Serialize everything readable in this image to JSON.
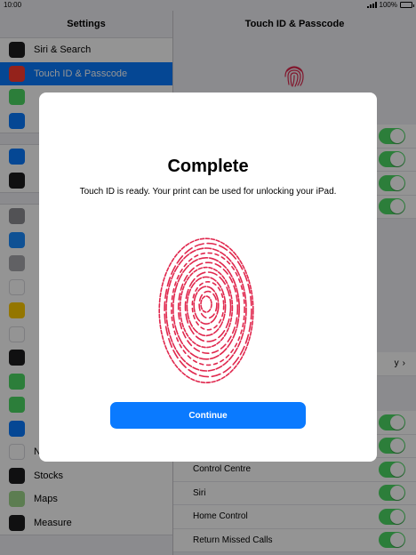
{
  "status_bar": {
    "time": "10:00",
    "battery": "100%"
  },
  "master": {
    "title": "Settings",
    "groups": [
      {
        "items": [
          {
            "label": "Siri & Search",
            "icon": "siri-icon",
            "color": "#1c1c1e"
          },
          {
            "label": "Touch ID & Passcode",
            "icon": "fingerprint-icon",
            "color": "#ff3b30",
            "selected": true
          },
          {
            "label": "",
            "icon": "battery-icon",
            "color": "#4cd964"
          },
          {
            "label": "",
            "icon": "privacy-hand-icon",
            "color": "#0a7aff"
          }
        ]
      },
      {
        "items": [
          {
            "label": "",
            "icon": "app-store-icon",
            "color": "#0a7aff"
          },
          {
            "label": "",
            "icon": "wallet-icon",
            "color": "#1c1c1e"
          }
        ]
      },
      {
        "items": [
          {
            "label": "",
            "icon": "passwords-key-icon",
            "color": "#8e8e93"
          },
          {
            "label": "",
            "icon": "mail-icon",
            "color": "#1a8cff"
          },
          {
            "label": "",
            "icon": "contacts-icon",
            "color": "#a8a8ad"
          },
          {
            "label": "",
            "icon": "calendar-icon",
            "color": "#ffffff"
          },
          {
            "label": "",
            "icon": "notes-icon",
            "color": "#ffcc00"
          },
          {
            "label": "",
            "icon": "reminders-icon",
            "color": "#ffffff"
          },
          {
            "label": "",
            "icon": "voice-memos-icon",
            "color": "#1c1c1e"
          },
          {
            "label": "",
            "icon": "messages-icon",
            "color": "#4cd964"
          },
          {
            "label": "",
            "icon": "facetime-icon",
            "color": "#4cd964"
          },
          {
            "label": "",
            "icon": "safari-icon",
            "color": "#0a7aff"
          },
          {
            "label": "News",
            "icon": "news-icon",
            "color": "#ffffff"
          },
          {
            "label": "Stocks",
            "icon": "stocks-icon",
            "color": "#1c1c1e"
          },
          {
            "label": "Maps",
            "icon": "maps-icon",
            "color": "#9fd88c"
          },
          {
            "label": "Measure",
            "icon": "measure-icon",
            "color": "#1c1c1e"
          }
        ]
      }
    ]
  },
  "detail": {
    "title": "Touch ID & Passcode",
    "partial_value": "y",
    "rows": [
      {
        "label": "Control Centre",
        "toggle": true
      },
      {
        "label": "Siri",
        "toggle": true
      },
      {
        "label": "Home Control",
        "toggle": true
      },
      {
        "label": "Return Missed Calls",
        "toggle": true
      }
    ]
  },
  "modal": {
    "title": "Complete",
    "message": "Touch ID is ready. Your print can be used for unlocking your iPad.",
    "continue_label": "Continue",
    "print_color": "#e0284e"
  },
  "colors": {
    "accent": "#0a7aff",
    "toggle_on": "#4cd964"
  }
}
